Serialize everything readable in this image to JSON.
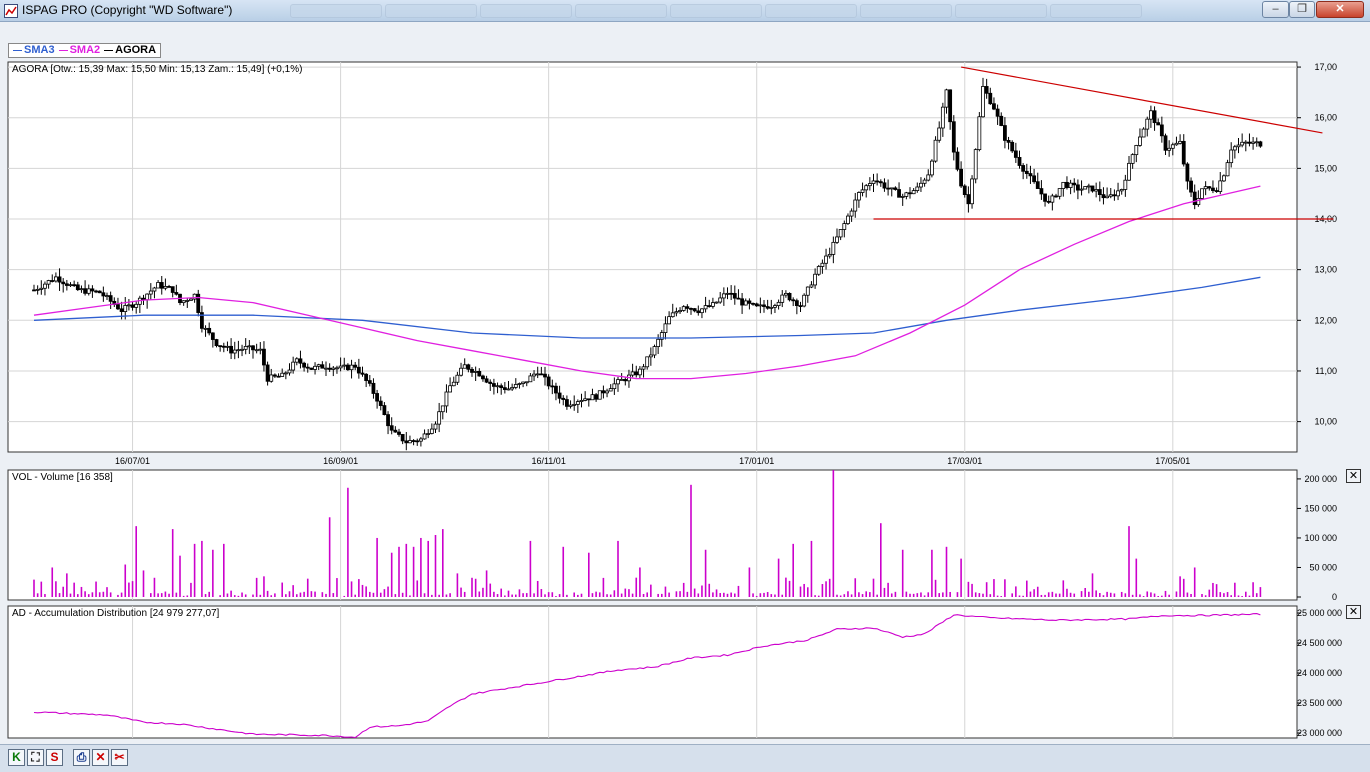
{
  "window": {
    "title": "ISPAG PRO (Copyright \"WD Software\")",
    "minimize": "–",
    "maximize": "❐",
    "close": "✕"
  },
  "colors": {
    "sma3": "#2f5fd0",
    "sma2": "#e020e0",
    "candles": "#000000",
    "trend": "#cc0000",
    "volume": "#cc00cc",
    "ad": "#cc00cc"
  },
  "legend": [
    {
      "label": "SMA3",
      "color": "#2f5fd0"
    },
    {
      "label": "SMA2",
      "color": "#e020e0"
    },
    {
      "label": "AGORA",
      "color": "#000000"
    }
  ],
  "price_panel": {
    "info": "AGORA [Otw.: 15,39  Max: 15,50  Min: 15,13  Zam.: 15,49] (+0,1%)",
    "y_ticks": [
      "17,00",
      "16,00",
      "15,00",
      "14,00",
      "13,00",
      "12,00",
      "11,00",
      "10,00"
    ],
    "x_ticks": [
      "16/07/01",
      "16/09/01",
      "16/11/01",
      "17/01/01",
      "17/03/01",
      "17/05/01"
    ]
  },
  "volume_panel": {
    "info": "VOL - Volume [16 358]",
    "y_ticks": [
      "200 000",
      "150 000",
      "100 000",
      "50 000",
      "0"
    ],
    "close_icon": "✕"
  },
  "ad_panel": {
    "info": "AD - Accumulation Distribution [24 979 277,07]",
    "y_ticks": [
      "25 000 000",
      "24 500 000",
      "24 000 000",
      "23 500 000",
      "23 000 000"
    ],
    "close_icon": "✕"
  },
  "toolbar": [
    {
      "label": "K",
      "color": "#0a7a0a",
      "icon": "k-icon"
    },
    {
      "label": "⛶",
      "color": "#222222",
      "icon": "fit-icon"
    },
    {
      "label": "S",
      "color": "#cc0000",
      "icon": "s-icon"
    },
    {
      "label": "⎙",
      "color": "#1a3d8f",
      "icon": "print-icon"
    },
    {
      "label": "✕",
      "color": "#cc0000",
      "icon": "delete-icon"
    },
    {
      "label": "✂",
      "color": "#cc0000",
      "icon": "cut-icon"
    }
  ],
  "chart_data": [
    {
      "type": "candlestick",
      "title": "AGORA",
      "x_ticks": [
        "16/07/01",
        "16/09/01",
        "16/11/01",
        "17/01/01",
        "17/03/01",
        "17/05/01"
      ],
      "ylim": [
        9.4,
        17.1
      ],
      "grid": true,
      "close_points": [
        [
          0,
          12.6
        ],
        [
          6,
          12.85
        ],
        [
          12,
          12.6
        ],
        [
          18,
          12.55
        ],
        [
          24,
          12.2
        ],
        [
          28,
          12.35
        ],
        [
          34,
          12.7
        ],
        [
          38,
          12.6
        ],
        [
          40,
          12.35
        ],
        [
          44,
          12.5
        ],
        [
          46,
          11.9
        ],
        [
          50,
          11.55
        ],
        [
          54,
          11.4
        ],
        [
          58,
          11.45
        ],
        [
          62,
          11.4
        ],
        [
          64,
          10.85
        ],
        [
          68,
          10.9
        ],
        [
          72,
          11.2
        ],
        [
          76,
          11.05
        ],
        [
          80,
          11.1
        ],
        [
          84,
          11.05
        ],
        [
          88,
          11.1
        ],
        [
          92,
          10.7
        ],
        [
          94,
          10.45
        ],
        [
          98,
          9.8
        ],
        [
          102,
          9.6
        ],
        [
          106,
          9.65
        ],
        [
          110,
          10.0
        ],
        [
          114,
          10.7
        ],
        [
          118,
          11.1
        ],
        [
          122,
          10.95
        ],
        [
          126,
          10.7
        ],
        [
          130,
          10.65
        ],
        [
          134,
          10.75
        ],
        [
          138,
          11.0
        ],
        [
          142,
          10.65
        ],
        [
          146,
          10.35
        ],
        [
          150,
          10.45
        ],
        [
          154,
          10.5
        ],
        [
          158,
          10.7
        ],
        [
          162,
          10.85
        ],
        [
          166,
          11.0
        ],
        [
          170,
          11.45
        ],
        [
          174,
          12.05
        ],
        [
          178,
          12.3
        ],
        [
          182,
          12.2
        ],
        [
          186,
          12.3
        ],
        [
          190,
          12.55
        ],
        [
          194,
          12.35
        ],
        [
          198,
          12.25
        ],
        [
          202,
          12.3
        ],
        [
          206,
          12.5
        ],
        [
          210,
          12.3
        ],
        [
          214,
          12.9
        ],
        [
          218,
          13.35
        ],
        [
          222,
          13.9
        ],
        [
          226,
          14.5
        ],
        [
          230,
          14.8
        ],
        [
          234,
          14.6
        ],
        [
          238,
          14.45
        ],
        [
          242,
          14.6
        ],
        [
          245,
          14.9
        ],
        [
          248,
          15.8
        ],
        [
          250,
          16.5
        ],
        [
          252,
          15.3
        ],
        [
          254,
          14.7
        ],
        [
          256,
          14.3
        ],
        [
          258,
          15.4
        ],
        [
          260,
          16.6
        ],
        [
          263,
          16.2
        ],
        [
          266,
          15.6
        ],
        [
          270,
          15.1
        ],
        [
          274,
          14.7
        ],
        [
          278,
          14.3
        ],
        [
          282,
          14.7
        ],
        [
          286,
          14.6
        ],
        [
          290,
          14.6
        ],
        [
          294,
          14.4
        ],
        [
          298,
          14.6
        ],
        [
          302,
          15.5
        ],
        [
          306,
          16.1
        ],
        [
          308,
          15.8
        ],
        [
          310,
          15.4
        ],
        [
          314,
          15.5
        ],
        [
          316,
          14.7
        ],
        [
          318,
          14.3
        ],
        [
          320,
          14.6
        ],
        [
          324,
          14.6
        ],
        [
          326,
          14.9
        ],
        [
          328,
          15.4
        ],
        [
          332,
          15.5
        ],
        [
          336,
          15.49
        ]
      ],
      "sma2_points": [
        [
          0,
          12.1
        ],
        [
          15,
          12.25
        ],
        [
          30,
          12.4
        ],
        [
          45,
          12.45
        ],
        [
          60,
          12.35
        ],
        [
          75,
          12.1
        ],
        [
          90,
          11.85
        ],
        [
          105,
          11.6
        ],
        [
          120,
          11.4
        ],
        [
          135,
          11.2
        ],
        [
          150,
          11.0
        ],
        [
          165,
          10.85
        ],
        [
          180,
          10.85
        ],
        [
          195,
          10.95
        ],
        [
          210,
          11.1
        ],
        [
          225,
          11.3
        ],
        [
          240,
          11.75
        ],
        [
          255,
          12.3
        ],
        [
          270,
          13.0
        ],
        [
          285,
          13.5
        ],
        [
          300,
          13.95
        ],
        [
          315,
          14.3
        ],
        [
          336,
          14.65
        ]
      ],
      "sma3_points": [
        [
          0,
          12.0
        ],
        [
          30,
          12.1
        ],
        [
          60,
          12.1
        ],
        [
          90,
          12.0
        ],
        [
          120,
          11.75
        ],
        [
          150,
          11.65
        ],
        [
          180,
          11.65
        ],
        [
          210,
          11.7
        ],
        [
          230,
          11.75
        ],
        [
          250,
          12.0
        ],
        [
          270,
          12.2
        ],
        [
          300,
          12.45
        ],
        [
          320,
          12.65
        ],
        [
          336,
          12.85
        ]
      ],
      "trendlines": [
        {
          "from": [
            254,
            17.0
          ],
          "to": [
            353,
            15.7
          ],
          "color": "#cc0000"
        },
        {
          "from": [
            230,
            14.0
          ],
          "to": [
            356,
            14.0
          ],
          "color": "#cc0000"
        }
      ]
    },
    {
      "type": "bar",
      "title": "VOL - Volume",
      "ylim": [
        0,
        210000
      ],
      "ticks": [
        0,
        50000,
        100000,
        150000,
        200000
      ],
      "spikes": [
        [
          5,
          50000
        ],
        [
          9,
          40000
        ],
        [
          25,
          55000
        ],
        [
          28,
          120000
        ],
        [
          30,
          45000
        ],
        [
          38,
          115000
        ],
        [
          40,
          70000
        ],
        [
          44,
          90000
        ],
        [
          46,
          95000
        ],
        [
          49,
          80000
        ],
        [
          52,
          90000
        ],
        [
          63,
          35000
        ],
        [
          81,
          135000
        ],
        [
          86,
          185000
        ],
        [
          94,
          100000
        ],
        [
          98,
          75000
        ],
        [
          100,
          85000
        ],
        [
          102,
          90000
        ],
        [
          104,
          85000
        ],
        [
          106,
          100000
        ],
        [
          108,
          95000
        ],
        [
          110,
          105000
        ],
        [
          112,
          115000
        ],
        [
          116,
          40000
        ],
        [
          124,
          45000
        ],
        [
          136,
          95000
        ],
        [
          145,
          85000
        ],
        [
          152,
          75000
        ],
        [
          160,
          95000
        ],
        [
          166,
          50000
        ],
        [
          180,
          190000
        ],
        [
          184,
          80000
        ],
        [
          196,
          50000
        ],
        [
          204,
          65000
        ],
        [
          208,
          90000
        ],
        [
          213,
          95000
        ],
        [
          219,
          215000
        ],
        [
          232,
          125000
        ],
        [
          238,
          80000
        ],
        [
          246,
          80000
        ],
        [
          250,
          85000
        ],
        [
          254,
          65000
        ],
        [
          266,
          30000
        ],
        [
          290,
          40000
        ],
        [
          300,
          120000
        ],
        [
          302,
          65000
        ],
        [
          314,
          35000
        ],
        [
          318,
          50000
        ],
        [
          334,
          25000
        ]
      ],
      "base_volume": 10000
    },
    {
      "type": "line",
      "title": "AD - Accumulation Distribution",
      "ylim": [
        22950000,
        25050000
      ],
      "ticks": [
        23000000,
        23500000,
        24000000,
        24500000,
        25000000
      ],
      "points": [
        [
          0,
          23350000
        ],
        [
          20,
          23300000
        ],
        [
          30,
          23180000
        ],
        [
          40,
          23150000
        ],
        [
          60,
          22980000
        ],
        [
          80,
          22960000
        ],
        [
          88,
          22930000
        ],
        [
          92,
          23100000
        ],
        [
          100,
          23120000
        ],
        [
          108,
          23200000
        ],
        [
          114,
          23450000
        ],
        [
          120,
          23650000
        ],
        [
          130,
          23750000
        ],
        [
          140,
          23850000
        ],
        [
          150,
          23950000
        ],
        [
          160,
          24050000
        ],
        [
          170,
          24100000
        ],
        [
          180,
          24250000
        ],
        [
          190,
          24300000
        ],
        [
          200,
          24450000
        ],
        [
          212,
          24550000
        ],
        [
          220,
          24730000
        ],
        [
          230,
          24750000
        ],
        [
          238,
          24600000
        ],
        [
          244,
          24650000
        ],
        [
          252,
          24970000
        ],
        [
          262,
          24920000
        ],
        [
          280,
          24880000
        ],
        [
          300,
          24900000
        ],
        [
          310,
          24960000
        ],
        [
          320,
          24960000
        ],
        [
          336,
          24979277
        ]
      ]
    }
  ]
}
